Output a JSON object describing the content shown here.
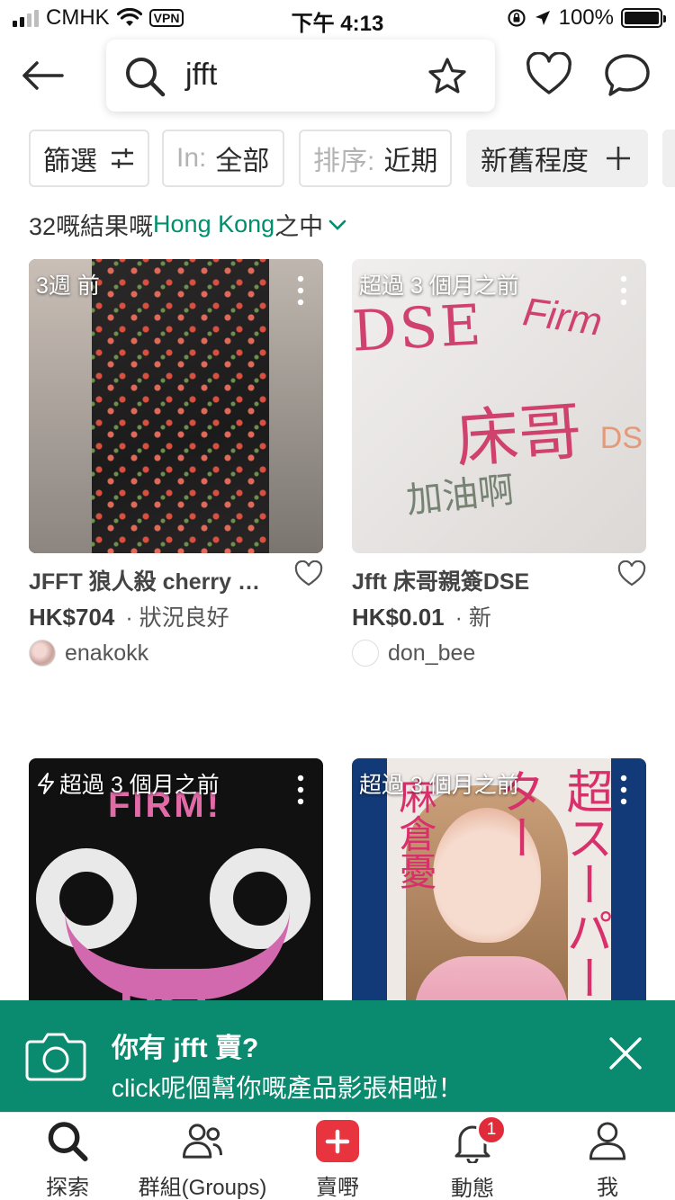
{
  "status_bar": {
    "carrier": "CMHK",
    "vpn": "VPN",
    "time": "下午 4:13",
    "battery": "100%"
  },
  "header": {
    "search_value": "jfft"
  },
  "filters": {
    "filter_label": "篩選",
    "in_prefix": "In:",
    "in_value": "全部",
    "sort_prefix": "排序:",
    "sort_value": "近期",
    "condition_label": "新舊程度"
  },
  "results": {
    "prefix": "32嘅結果嘅",
    "location": "Hong Kong",
    "suffix": "之中"
  },
  "listings": [
    {
      "age": "3週 前",
      "title": "JFFT 狼人殺 cherry 原…",
      "price": "HK$704",
      "condition": "· 狀況良好",
      "seller": "enakokk"
    },
    {
      "age": "超過 3 個月之前",
      "title": "Jfft 床哥親簽DSE",
      "price": "HK$0.01",
      "condition": "· 新",
      "seller": "don_bee"
    },
    {
      "age": "超過 3 個月之前",
      "boosted": true
    },
    {
      "age": "超過 3 個月之前"
    }
  ],
  "art_text": {
    "sign_1": "DSE",
    "sign_2": "Firm",
    "sign_3": "床哥",
    "sign_4": "加油啊",
    "sign_5": "DS",
    "firm": "FIRM!",
    "dse": "DSE",
    "dvd_1": "麻倉憂",
    "dvd_2": "超スーパースター"
  },
  "banner": {
    "title": "你有 jfft 賣?",
    "subtitle": "click呢個幫你嘅產品影張相啦！"
  },
  "tabbar": [
    {
      "label": "探索"
    },
    {
      "label": "群組(Groups)"
    },
    {
      "label": "賣嘢"
    },
    {
      "label": "動態",
      "badge": "1"
    },
    {
      "label": "我"
    }
  ],
  "colors": {
    "accent": "#0a8a6e",
    "location_link": "#008f6c",
    "sell": "#e8343f",
    "badge": "#e02b3a"
  }
}
